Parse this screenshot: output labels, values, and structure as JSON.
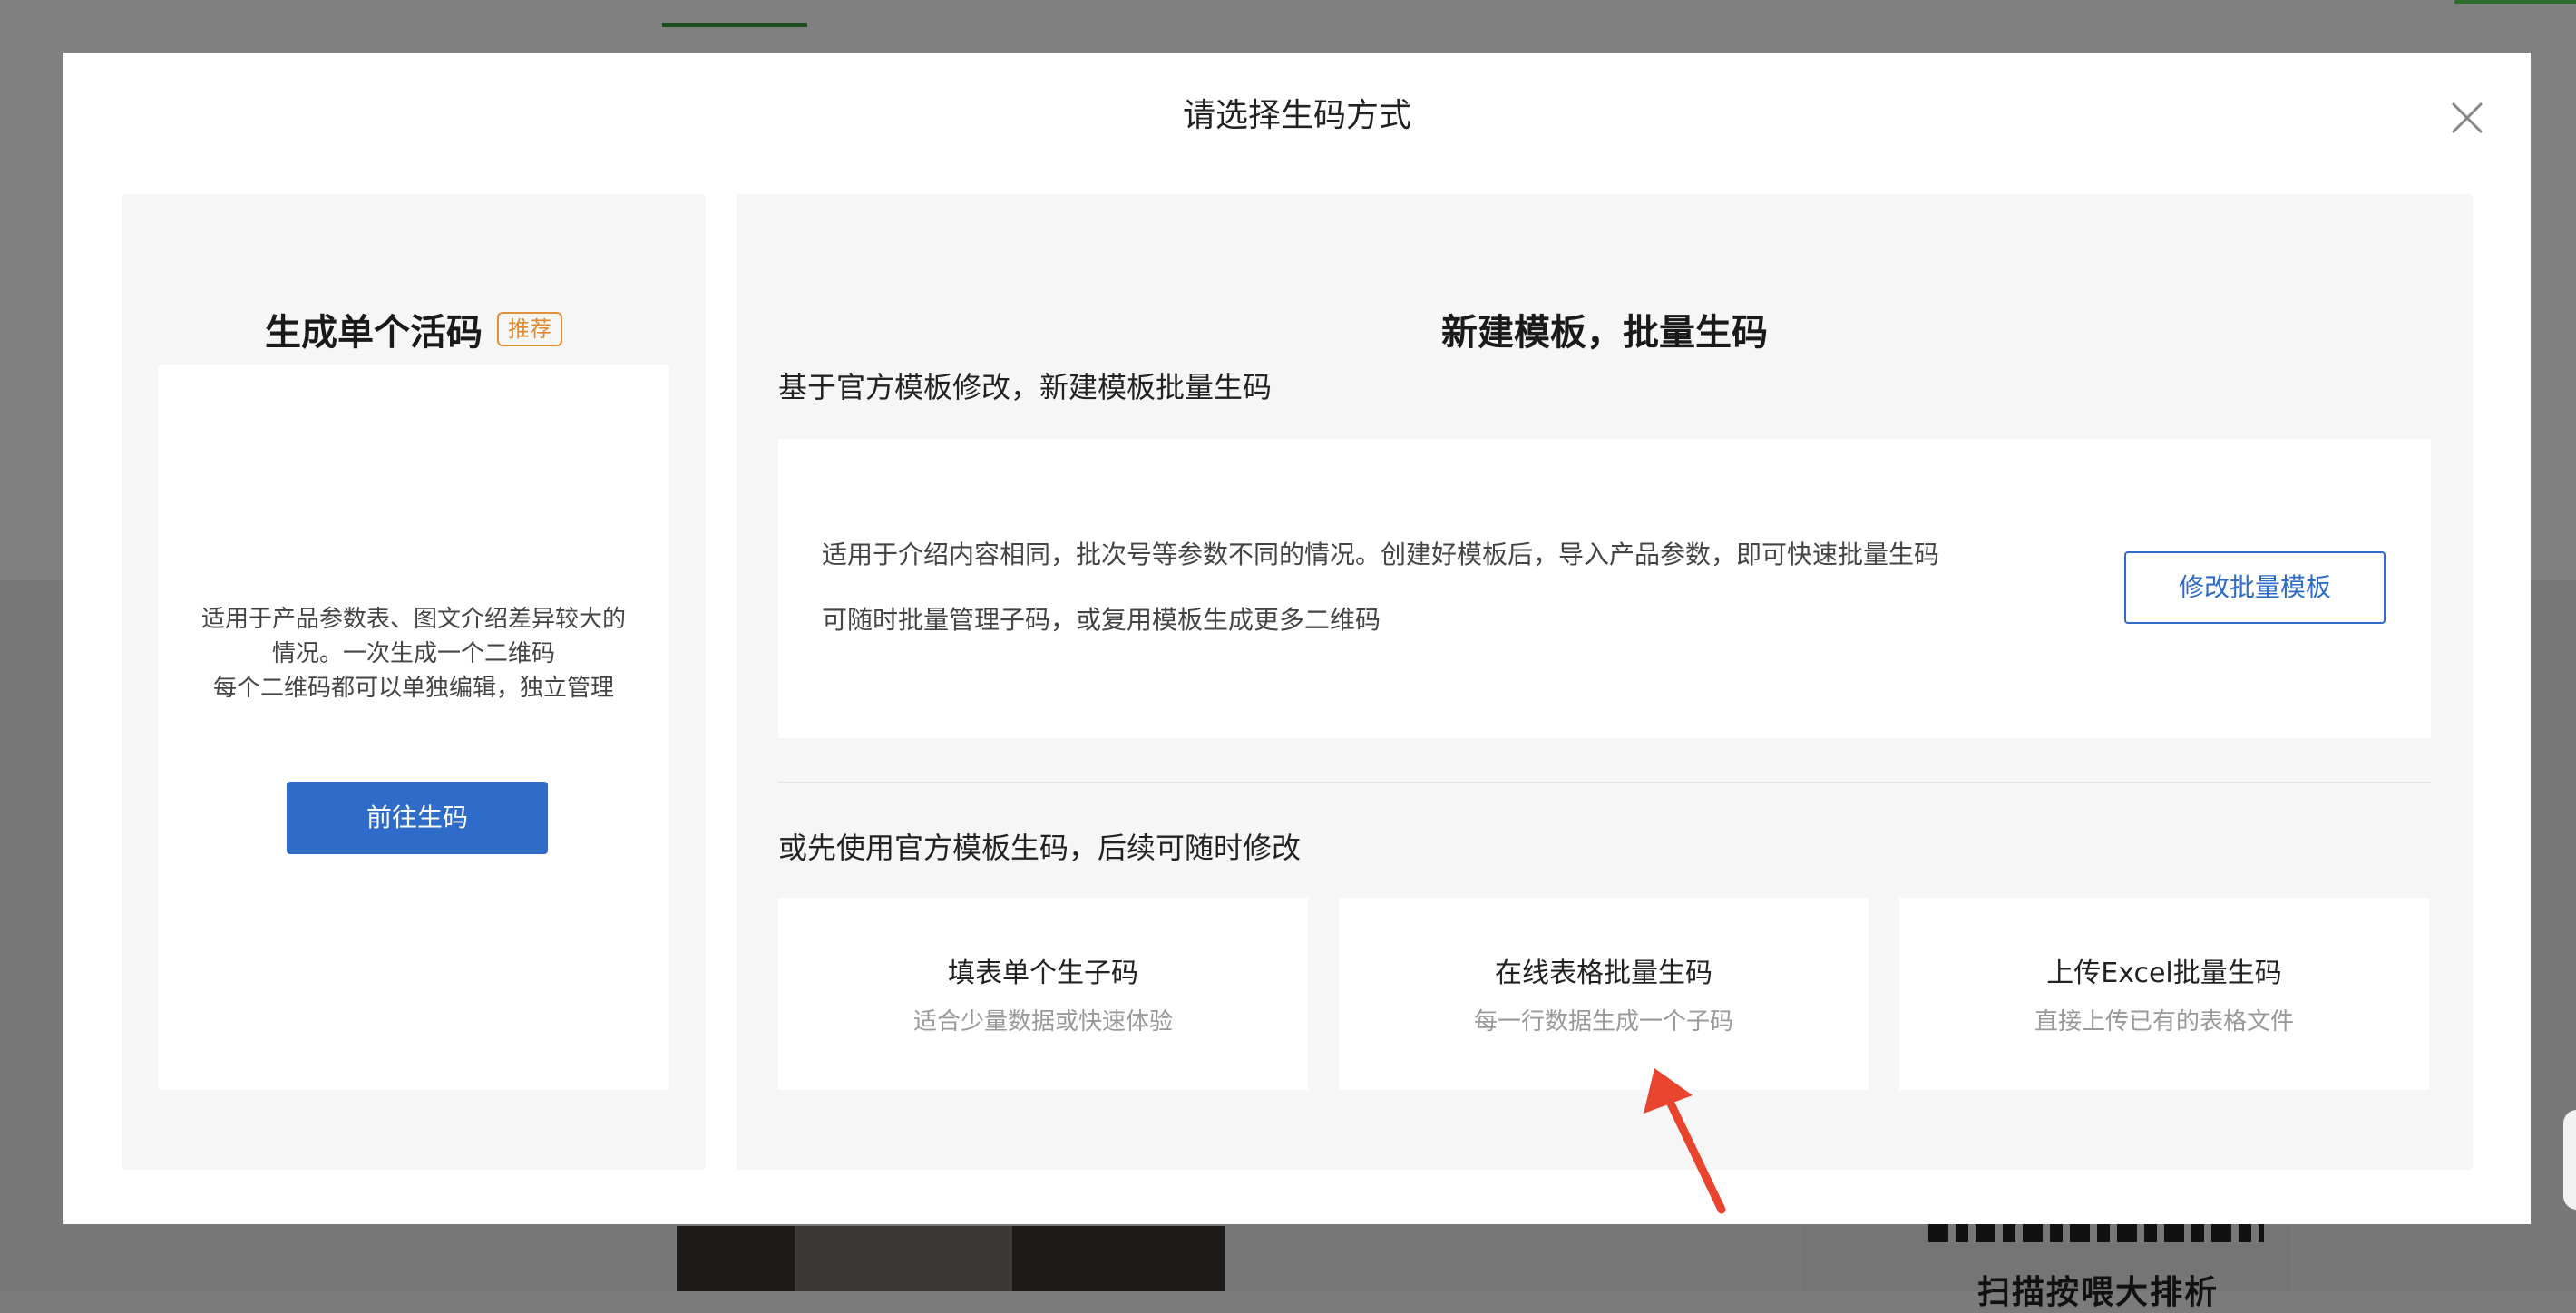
{
  "modal": {
    "title": "请选择生码方式",
    "close_icon": "close-icon"
  },
  "single": {
    "title": "生成单个活码",
    "badge": "推荐",
    "desc_line1": "适用于产品参数表、图文介绍差异较大的情况。一次生成一个二维码",
    "desc_line2": "每个二维码都可以单独编辑，独立管理",
    "button": "前往生码"
  },
  "batch": {
    "title": "新建模板，批量生码",
    "section1_heading": "基于官方模板修改，新建模板批量生码",
    "template_desc1": "适用于介绍内容相同，批次号等参数不同的情况。创建好模板后，导入产品参数，即可快速批量生码",
    "template_desc2": "可随时批量管理子码，或复用模板生成更多二维码",
    "edit_button": "修改批量模板",
    "section2_heading": "或先使用官方模板生码，后续可随时修改",
    "options": [
      {
        "title": "填表单个生子码",
        "subtitle": "适合少量数据或快速体验"
      },
      {
        "title": "在线表格批量生码",
        "subtitle": "每一行数据生成一个子码"
      },
      {
        "title": "上传Excel批量生码",
        "subtitle": "直接上传已有的表格文件"
      }
    ]
  },
  "background": {
    "partial_text": "扫描按喂大排析"
  },
  "colors": {
    "primary": "#2f6bc8",
    "badge": "#e08a2e",
    "annotation_arrow": "#e8442e"
  }
}
